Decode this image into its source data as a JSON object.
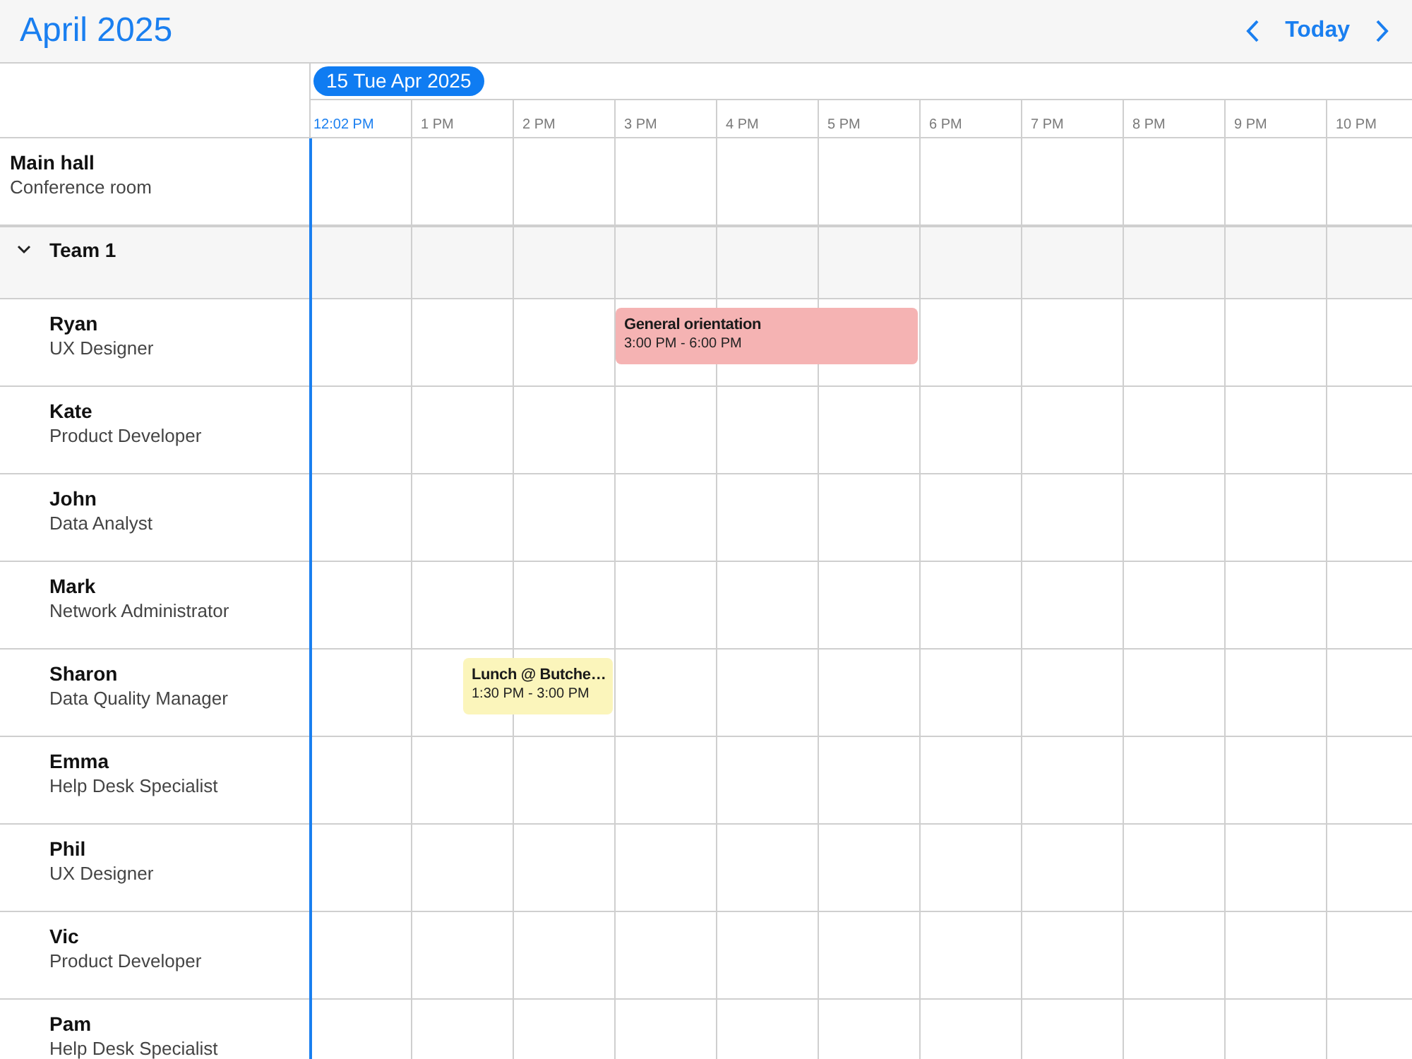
{
  "header": {
    "title": "April 2025",
    "today": "Today"
  },
  "timeline": {
    "date": "15 Tue Apr 2025",
    "hours": [
      {
        "label": "12:02 PM",
        "current": true
      },
      {
        "label": "1 PM",
        "current": false
      },
      {
        "label": "2 PM",
        "current": false
      },
      {
        "label": "3 PM",
        "current": false
      },
      {
        "label": "4 PM",
        "current": false
      },
      {
        "label": "5 PM",
        "current": false
      },
      {
        "label": "6 PM",
        "current": false
      },
      {
        "label": "7 PM",
        "current": false
      },
      {
        "label": "8 PM",
        "current": false
      },
      {
        "label": "9 PM",
        "current": false
      },
      {
        "label": "10 PM",
        "current": false
      }
    ]
  },
  "rows": [
    {
      "kind": "resource",
      "name": "Main hall",
      "subtitle": "Conference room"
    },
    {
      "kind": "group",
      "name": "Team 1",
      "expanded": true,
      "children": [
        {
          "kind": "resource",
          "name": "Ryan",
          "subtitle": "UX Designer",
          "events": [
            {
              "title": "General orientation",
              "time": "3:00 PM - 6:00 PM",
              "color": "#f5b3b3"
            }
          ]
        },
        {
          "kind": "resource",
          "name": "Kate",
          "subtitle": "Product Developer"
        },
        {
          "kind": "resource",
          "name": "John",
          "subtitle": "Data Analyst"
        },
        {
          "kind": "resource",
          "name": "Mark",
          "subtitle": "Network Administrator"
        },
        {
          "kind": "resource",
          "name": "Sharon",
          "subtitle": "Data Quality Manager",
          "events": [
            {
              "title": "Lunch @ Butche…",
              "time": "1:30 PM - 3:00 PM",
              "color": "#fbf5bb"
            }
          ]
        },
        {
          "kind": "resource",
          "name": "Emma",
          "subtitle": "Help Desk Specialist"
        },
        {
          "kind": "resource",
          "name": "Phil",
          "subtitle": "UX Designer"
        },
        {
          "kind": "resource",
          "name": "Vic",
          "subtitle": "Product Developer"
        },
        {
          "kind": "resource",
          "name": "Pam",
          "subtitle": "Help Desk Specialist"
        }
      ]
    }
  ]
}
